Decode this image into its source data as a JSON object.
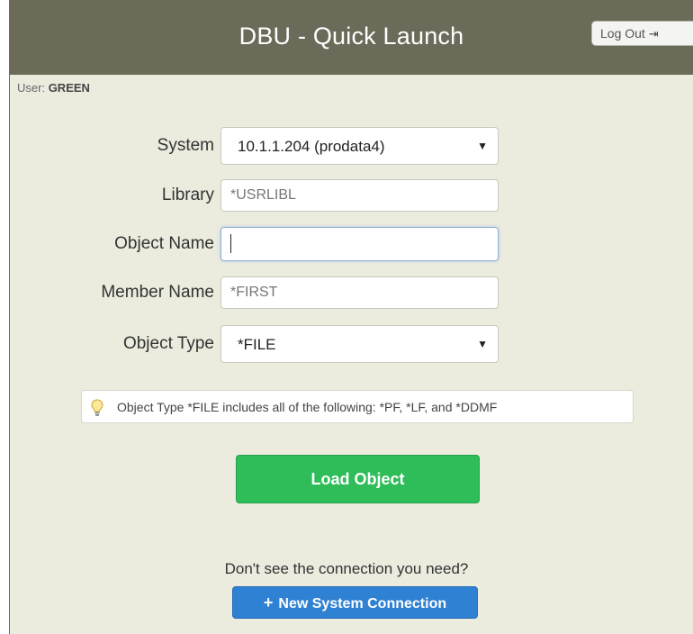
{
  "header": {
    "title": "DBU - Quick Launch",
    "logout_label": "Log Out",
    "logout_icon": "sign-out-icon"
  },
  "user": {
    "prefix": "User:",
    "name": "GREEN"
  },
  "form": {
    "system": {
      "label": "System",
      "value": "10.1.1.204 (prodata4)"
    },
    "library": {
      "label": "Library",
      "placeholder": "*USRLIBL"
    },
    "object_name": {
      "label": "Object Name",
      "value": ""
    },
    "member_name": {
      "label": "Member Name",
      "placeholder": "*FIRST"
    },
    "object_type": {
      "label": "Object Type",
      "value": "*FILE"
    }
  },
  "tip": {
    "icon": "lightbulb-icon",
    "text": "Object Type *FILE includes all of the following: *PF, *LF, and *DDMF"
  },
  "load_button": "Load Object",
  "help_text": "Don't see the connection you need?",
  "new_connection_button": "New System Connection",
  "colors": {
    "header_bg": "#6c6b59",
    "page_bg": "#ebebde",
    "load_green": "#2ebd59",
    "new_conn_blue": "#2f81d4"
  }
}
